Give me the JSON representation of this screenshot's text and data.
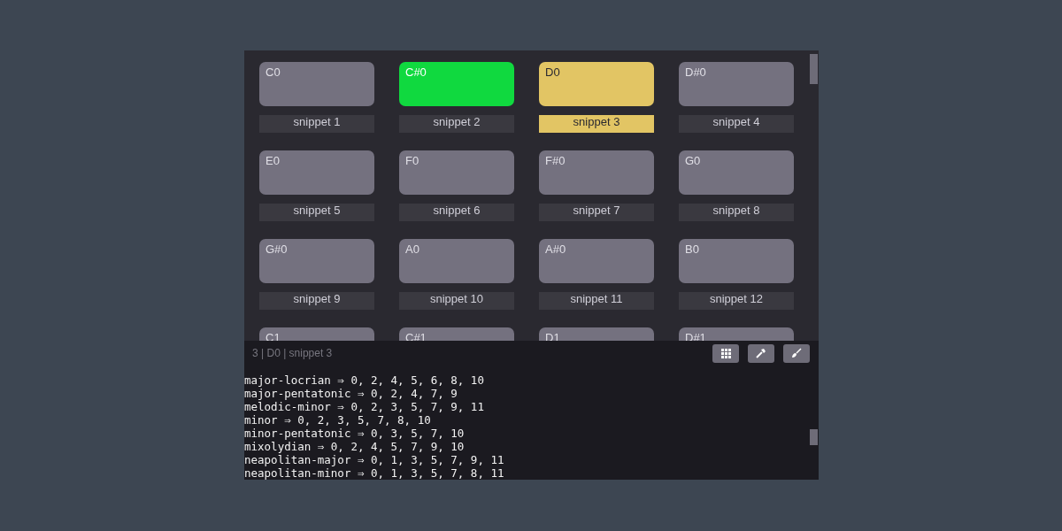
{
  "pads": [
    {
      "note": "C0",
      "label": "snippet 1",
      "playing": false,
      "selected": false
    },
    {
      "note": "C#0",
      "label": "snippet 2",
      "playing": true,
      "selected": false
    },
    {
      "note": "D0",
      "label": "snippet 3",
      "playing": false,
      "selected": true
    },
    {
      "note": "D#0",
      "label": "snippet 4",
      "playing": false,
      "selected": false
    },
    {
      "note": "E0",
      "label": "snippet 5",
      "playing": false,
      "selected": false
    },
    {
      "note": "F0",
      "label": "snippet 6",
      "playing": false,
      "selected": false
    },
    {
      "note": "F#0",
      "label": "snippet 7",
      "playing": false,
      "selected": false
    },
    {
      "note": "G0",
      "label": "snippet 8",
      "playing": false,
      "selected": false
    },
    {
      "note": "G#0",
      "label": "snippet 9",
      "playing": false,
      "selected": false
    },
    {
      "note": "A0",
      "label": "snippet 10",
      "playing": false,
      "selected": false
    },
    {
      "note": "A#0",
      "label": "snippet 11",
      "playing": false,
      "selected": false
    },
    {
      "note": "B0",
      "label": "snippet 12",
      "playing": false,
      "selected": false
    },
    {
      "note": "C1",
      "playing": false,
      "selected": false
    },
    {
      "note": "C#1",
      "playing": false,
      "selected": false
    },
    {
      "note": "D1",
      "playing": false,
      "selected": false
    },
    {
      "note": "D#1",
      "playing": false,
      "selected": false
    }
  ],
  "status_bar": {
    "text": "3 | D0 | snippet 3",
    "buttons": [
      {
        "kind": "grid"
      },
      {
        "kind": "hammer"
      },
      {
        "kind": "brush"
      }
    ]
  },
  "console": {
    "lines": [
      "major-locrian ⇒ 0, 2, 4, 5, 6, 8, 10",
      "major-pentatonic ⇒ 0, 2, 4, 7, 9",
      "melodic-minor ⇒ 0, 2, 3, 5, 7, 9, 11",
      "minor ⇒ 0, 2, 3, 5, 7, 8, 10",
      "minor-pentatonic ⇒ 0, 3, 5, 7, 10",
      "mixolydian ⇒ 0, 2, 4, 5, 7, 9, 10",
      "neapolitan-major ⇒ 0, 1, 3, 5, 7, 9, 11",
      "neapolitan-minor ⇒ 0, 1, 3, 5, 7, 8, 11"
    ]
  }
}
